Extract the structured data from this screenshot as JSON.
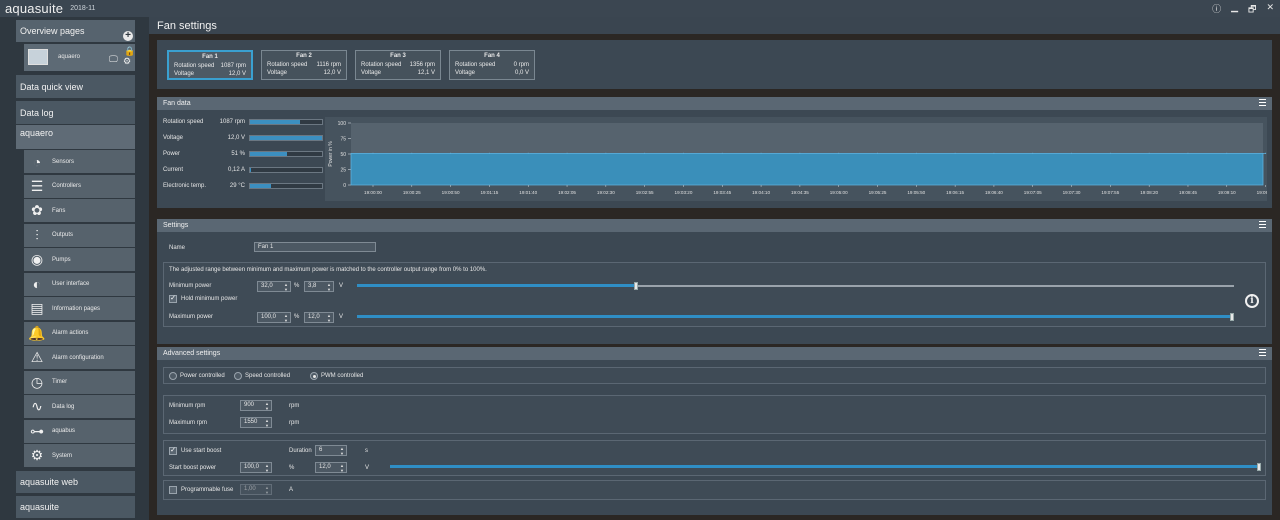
{
  "app": {
    "name": "aquasuite",
    "version": "2018-11"
  },
  "window_controls": {
    "info": "ⓘ",
    "minimize": "▁",
    "restore": "🗗",
    "close": "✕"
  },
  "sidebar": {
    "overview": "Overview pages",
    "page_label": "aquaero",
    "quick_view": "Data quick view",
    "data_log": "Data log",
    "device": "aquaero",
    "items": [
      {
        "label": "Sensors",
        "icon": "gauge-icon"
      },
      {
        "label": "Controllers",
        "icon": "sliders-icon"
      },
      {
        "label": "Fans",
        "icon": "fan-icon"
      },
      {
        "label": "Outputs",
        "icon": "outputs-icon"
      },
      {
        "label": "Pumps",
        "icon": "pump-icon"
      },
      {
        "label": "User interface",
        "icon": "user-interface-icon"
      },
      {
        "label": "Information pages",
        "icon": "pages-icon"
      },
      {
        "label": "Alarm actions",
        "icon": "bell-icon"
      },
      {
        "label": "Alarm configuration",
        "icon": "alarm-config-icon"
      },
      {
        "label": "Timer",
        "icon": "timer-icon"
      },
      {
        "label": "Data log",
        "icon": "chart-icon"
      },
      {
        "label": "aquabus",
        "icon": "network-icon"
      },
      {
        "label": "System",
        "icon": "gear-icon"
      }
    ],
    "web": "aquasuite web",
    "suite": "aquasuite"
  },
  "main": {
    "title": "Fan settings",
    "fans": [
      {
        "name": "Fan 1",
        "speed_label": "Rotation speed",
        "speed": "1087 rpm",
        "voltage_label": "Voltage",
        "voltage": "12,0 V"
      },
      {
        "name": "Fan 2",
        "speed_label": "Rotation speed",
        "speed": "1116 rpm",
        "voltage_label": "Voltage",
        "voltage": "12,0 V"
      },
      {
        "name": "Fan 3",
        "speed_label": "Rotation speed",
        "speed": "1356 rpm",
        "voltage_label": "Voltage",
        "voltage": "12,1 V"
      },
      {
        "name": "Fan 4",
        "speed_label": "Rotation speed",
        "speed": "0 rpm",
        "voltage_label": "Voltage",
        "voltage": "0,0 V"
      }
    ],
    "fan_data": {
      "title": "Fan data",
      "rows": [
        {
          "label": "Rotation speed",
          "value": "1087 rpm",
          "level": 0.7
        },
        {
          "label": "Voltage",
          "value": "12,0 V",
          "level": 1.0
        },
        {
          "label": "Power",
          "value": "51 %",
          "level": 0.51
        },
        {
          "label": "Current",
          "value": "0,12 A",
          "level": 0.02
        },
        {
          "label": "Electronic temp.",
          "value": "29 °C",
          "level": 0.29
        }
      ]
    },
    "settings": {
      "title": "Settings",
      "name_label": "Name",
      "name_value": "Fan 1",
      "note": "The adjusted range between minimum and maximum power is matched to the controller output range from 0% to 100%.",
      "min_power_label": "Minimum power",
      "min_power": "32,0",
      "min_voltage": "3,8",
      "hold_label": "Hold minimum power",
      "hold_checked": "✓",
      "max_power_label": "Maximum power",
      "max_power": "100,0",
      "max_voltage": "12,0",
      "pct_unit": "%",
      "v_unit": "V",
      "min_level": 0.32,
      "max_level": 1.0
    },
    "advanced": {
      "title": "Advanced settings",
      "modes": [
        "Power controlled",
        "Speed controlled",
        "PWM controlled"
      ],
      "selected_mode": "PWM controlled",
      "min_rpm_label": "Minimum rpm",
      "min_rpm": "900",
      "max_rpm_label": "Maximum rpm",
      "max_rpm": "1550",
      "rpm_unit": "rpm",
      "start_boost_label": "Use start boost",
      "start_boost_checked": "✓",
      "duration_label": "Duration",
      "duration": "6",
      "duration_unit": "s",
      "boost_power_label": "Start boost power",
      "boost_power": "100,0",
      "boost_pct_unit": "%",
      "boost_voltage": "12,0",
      "boost_v_unit": "V",
      "boost_level": 1.0,
      "fuse_label": "Programmable fuse",
      "fuse_value": "1,00",
      "fuse_unit": "A"
    }
  },
  "chart_data": {
    "type": "area",
    "ylabel": "Power in %",
    "ylim": [
      0,
      100
    ],
    "yticks": [
      "100",
      "75",
      "50",
      "25",
      "0"
    ],
    "x": [
      "19:00:00",
      "19:00:25",
      "19:00:50",
      "19:01:15",
      "19:01:40",
      "19:02:05",
      "19:02:30",
      "19:02:55",
      "19:03:20",
      "19:03:45",
      "19:04:10",
      "19:04:35",
      "19:05:00",
      "19:05:25",
      "19:05:50",
      "19:06:15",
      "19:06:40",
      "19:07:05",
      "19:07:30",
      "19:07:55",
      "19:08:20",
      "19:08:45",
      "19:09:10",
      "19:09:35"
    ],
    "series": [
      {
        "values": [
          51,
          51,
          51,
          51,
          51,
          51,
          51,
          51,
          51,
          51,
          51,
          51,
          51,
          51,
          51,
          51,
          51,
          51,
          51,
          51,
          51,
          51,
          51,
          51
        ]
      }
    ],
    "color": "#3a8fba"
  }
}
